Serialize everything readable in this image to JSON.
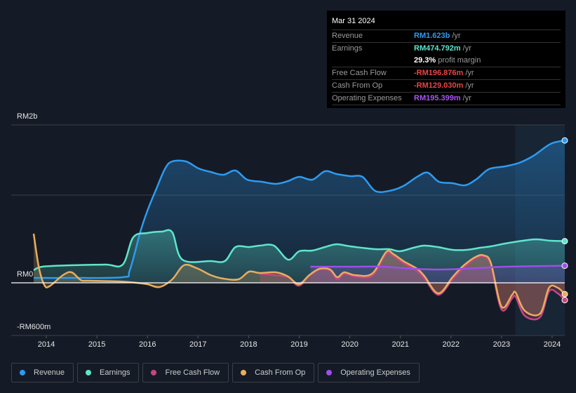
{
  "tooltip": {
    "date": "Mar 31 2024",
    "rows": [
      {
        "label": "Revenue",
        "value": "RM1.623b",
        "unit": "/yr",
        "color": "#2d9bf0"
      },
      {
        "label": "Earnings",
        "value": "RM474.792m",
        "unit": "/yr",
        "color": "#5ee6cc"
      },
      {
        "label": "",
        "value": "29.3%",
        "unit": "profit margin",
        "color": "#ffffff"
      },
      {
        "label": "Free Cash Flow",
        "value": "-RM196.876m",
        "unit": "/yr",
        "color": "#e84545"
      },
      {
        "label": "Cash From Op",
        "value": "-RM129.030m",
        "unit": "/yr",
        "color": "#e84545"
      },
      {
        "label": "Operating Expenses",
        "value": "RM195.399m",
        "unit": "/yr",
        "color": "#a855f7"
      }
    ]
  },
  "legend": [
    {
      "label": "Revenue",
      "color": "#2d9bf0"
    },
    {
      "label": "Earnings",
      "color": "#5ee6cc"
    },
    {
      "label": "Free Cash Flow",
      "color": "#c8457f"
    },
    {
      "label": "Cash From Op",
      "color": "#e8ad5f"
    },
    {
      "label": "Operating Expenses",
      "color": "#9d4fe8"
    }
  ],
  "chart_data": {
    "type": "area",
    "title": "",
    "xlabel": "",
    "ylabel": "",
    "unit": "RM millions",
    "ylim": [
      -600,
      1800
    ],
    "xlim": [
      2013.75,
      2024.25
    ],
    "y_tick_labels": [
      {
        "value": 1800,
        "label": "RM2b"
      },
      {
        "value": 0,
        "label": "RM0"
      },
      {
        "value": -600,
        "label": "-RM600m"
      }
    ],
    "x_ticks": [
      2014,
      2015,
      2016,
      2017,
      2018,
      2019,
      2020,
      2021,
      2022,
      2023,
      2024
    ],
    "highlight_range": [
      2023.27,
      2024.25
    ],
    "grid": true,
    "series": [
      {
        "name": "Revenue",
        "color": "#2d9bf0",
        "points": [
          [
            2013.75,
            56
          ],
          [
            2014.47,
            56
          ],
          [
            2015.51,
            64
          ],
          [
            2015.65,
            144
          ],
          [
            2015.86,
            584
          ],
          [
            2016.0,
            824
          ],
          [
            2016.17,
            1064
          ],
          [
            2016.35,
            1304
          ],
          [
            2016.49,
            1384
          ],
          [
            2016.76,
            1384
          ],
          [
            2017.01,
            1304
          ],
          [
            2017.25,
            1264
          ],
          [
            2017.5,
            1232
          ],
          [
            2017.74,
            1280
          ],
          [
            2017.97,
            1176
          ],
          [
            2018.26,
            1152
          ],
          [
            2018.54,
            1128
          ],
          [
            2018.78,
            1160
          ],
          [
            2019.0,
            1208
          ],
          [
            2019.26,
            1176
          ],
          [
            2019.51,
            1272
          ],
          [
            2019.74,
            1240
          ],
          [
            2020.01,
            1216
          ],
          [
            2020.25,
            1208
          ],
          [
            2020.5,
            1048
          ],
          [
            2020.78,
            1048
          ],
          [
            2021.06,
            1104
          ],
          [
            2021.33,
            1208
          ],
          [
            2021.54,
            1256
          ],
          [
            2021.76,
            1152
          ],
          [
            2022.03,
            1136
          ],
          [
            2022.28,
            1112
          ],
          [
            2022.51,
            1184
          ],
          [
            2022.75,
            1296
          ],
          [
            2023.07,
            1328
          ],
          [
            2023.35,
            1368
          ],
          [
            2023.63,
            1448
          ],
          [
            2023.97,
            1584
          ],
          [
            2024.25,
            1623
          ]
        ]
      },
      {
        "name": "Earnings",
        "color": "#5ee6cc",
        "points": [
          [
            2013.75,
            144
          ],
          [
            2013.92,
            184
          ],
          [
            2014.47,
            200
          ],
          [
            2015.17,
            208
          ],
          [
            2015.51,
            208
          ],
          [
            2015.72,
            520
          ],
          [
            2016.0,
            568
          ],
          [
            2016.28,
            584
          ],
          [
            2016.49,
            576
          ],
          [
            2016.69,
            264
          ],
          [
            2017.25,
            248
          ],
          [
            2017.53,
            248
          ],
          [
            2017.74,
            408
          ],
          [
            2018.01,
            408
          ],
          [
            2018.22,
            424
          ],
          [
            2018.5,
            424
          ],
          [
            2018.78,
            264
          ],
          [
            2019.0,
            360
          ],
          [
            2019.26,
            368
          ],
          [
            2019.51,
            408
          ],
          [
            2019.74,
            440
          ],
          [
            2020.01,
            416
          ],
          [
            2020.5,
            384
          ],
          [
            2020.78,
            384
          ],
          [
            2020.99,
            360
          ],
          [
            2021.26,
            400
          ],
          [
            2021.47,
            424
          ],
          [
            2021.74,
            408
          ],
          [
            2022.03,
            376
          ],
          [
            2022.31,
            376
          ],
          [
            2022.58,
            400
          ],
          [
            2022.79,
            416
          ],
          [
            2023.07,
            448
          ],
          [
            2023.42,
            480
          ],
          [
            2023.69,
            496
          ],
          [
            2023.97,
            480
          ],
          [
            2024.25,
            475
          ]
        ]
      },
      {
        "name": "Free Cash Flow",
        "color": "#c8457f",
        "points": [
          [
            2018.22,
            104
          ],
          [
            2018.5,
            88
          ],
          [
            2018.78,
            64
          ],
          [
            2018.99,
            -32
          ],
          [
            2019.2,
            80
          ],
          [
            2019.4,
            152
          ],
          [
            2019.61,
            136
          ],
          [
            2019.75,
            40
          ],
          [
            2019.89,
            104
          ],
          [
            2020.1,
            72
          ],
          [
            2020.44,
            80
          ],
          [
            2020.72,
            328
          ],
          [
            2020.86,
            304
          ],
          [
            2021.06,
            224
          ],
          [
            2021.33,
            136
          ],
          [
            2021.47,
            56
          ],
          [
            2021.75,
            -136
          ],
          [
            2022.03,
            40
          ],
          [
            2022.24,
            168
          ],
          [
            2022.49,
            280
          ],
          [
            2022.65,
            296
          ],
          [
            2022.79,
            200
          ],
          [
            2023.0,
            -304
          ],
          [
            2023.21,
            -176
          ],
          [
            2023.28,
            -160
          ],
          [
            2023.46,
            -376
          ],
          [
            2023.76,
            -392
          ],
          [
            2023.94,
            -96
          ],
          [
            2024.11,
            -120
          ],
          [
            2024.25,
            -197
          ]
        ]
      },
      {
        "name": "Cash From Op",
        "color": "#e8ad5f",
        "points": [
          [
            2013.75,
            560
          ],
          [
            2013.85,
            184
          ],
          [
            2013.96,
            -24
          ],
          [
            2014.06,
            -40
          ],
          [
            2014.33,
            88
          ],
          [
            2014.5,
            120
          ],
          [
            2014.68,
            32
          ],
          [
            2014.82,
            24
          ],
          [
            2015.44,
            16
          ],
          [
            2015.79,
            0
          ],
          [
            2016.0,
            -16
          ],
          [
            2016.24,
            -48
          ],
          [
            2016.49,
            40
          ],
          [
            2016.72,
            200
          ],
          [
            2016.97,
            168
          ],
          [
            2017.25,
            88
          ],
          [
            2017.5,
            48
          ],
          [
            2017.8,
            40
          ],
          [
            2018.01,
            128
          ],
          [
            2018.22,
            112
          ],
          [
            2018.54,
            120
          ],
          [
            2018.78,
            72
          ],
          [
            2018.99,
            -16
          ],
          [
            2019.2,
            88
          ],
          [
            2019.4,
            160
          ],
          [
            2019.61,
            152
          ],
          [
            2019.75,
            64
          ],
          [
            2019.89,
            120
          ],
          [
            2020.1,
            88
          ],
          [
            2020.44,
            104
          ],
          [
            2020.72,
            352
          ],
          [
            2020.86,
            328
          ],
          [
            2021.06,
            248
          ],
          [
            2021.33,
            160
          ],
          [
            2021.47,
            80
          ],
          [
            2021.75,
            -120
          ],
          [
            2022.03,
            64
          ],
          [
            2022.24,
            192
          ],
          [
            2022.49,
            296
          ],
          [
            2022.65,
            312
          ],
          [
            2022.79,
            224
          ],
          [
            2023.0,
            -272
          ],
          [
            2023.21,
            -136
          ],
          [
            2023.28,
            -112
          ],
          [
            2023.46,
            -320
          ],
          [
            2023.76,
            -352
          ],
          [
            2023.94,
            -56
          ],
          [
            2024.11,
            -56
          ],
          [
            2024.25,
            -129
          ]
        ]
      },
      {
        "name": "Operating Expenses",
        "color": "#9d4fe8",
        "points": [
          [
            2019.22,
            184
          ],
          [
            2020.01,
            184
          ],
          [
            2020.63,
            184
          ],
          [
            2021.26,
            160
          ],
          [
            2021.81,
            152
          ],
          [
            2022.51,
            168
          ],
          [
            2023.07,
            184
          ],
          [
            2024.25,
            195
          ]
        ]
      }
    ]
  }
}
